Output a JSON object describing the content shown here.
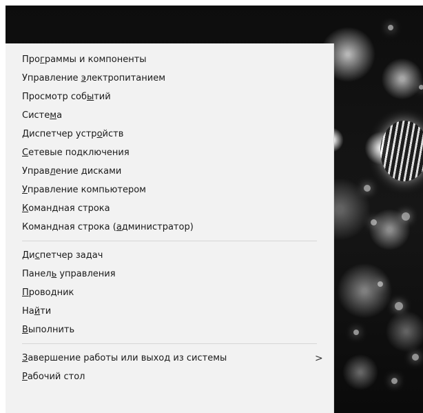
{
  "menu": {
    "items": [
      {
        "pre": "Про",
        "acc": "г",
        "post": "раммы и компоненты"
      },
      {
        "pre": "Управление ",
        "acc": "э",
        "post": "лектропитанием"
      },
      {
        "pre": "Просмотр соб",
        "acc": "ы",
        "post": "тий"
      },
      {
        "pre": "Систе",
        "acc": "м",
        "post": "а"
      },
      {
        "pre": "Диспетчер устр",
        "acc": "о",
        "post": "йств"
      },
      {
        "pre": "",
        "acc": "С",
        "post": "етевые подключения"
      },
      {
        "pre": "Управ",
        "acc": "л",
        "post": "ение дисками"
      },
      {
        "pre": "",
        "acc": "У",
        "post": "правление компьютером"
      },
      {
        "pre": "",
        "acc": "К",
        "post": "омандная строка"
      },
      {
        "pre": "Командная строка (",
        "acc": "а",
        "post": "дминистратор)"
      },
      {
        "pre": "Ди",
        "acc": "с",
        "post": "петчер задач"
      },
      {
        "pre": "Панел",
        "acc": "ь",
        "post": " управления"
      },
      {
        "pre": "",
        "acc": "П",
        "post": "роводник"
      },
      {
        "pre": "На",
        "acc": "й",
        "post": "ти"
      },
      {
        "pre": "",
        "acc": "В",
        "post": "ыполнить"
      },
      {
        "pre": "",
        "acc": "З",
        "post": "авершение работы или выход из системы"
      },
      {
        "pre": "",
        "acc": "Р",
        "post": "абочий стол"
      }
    ],
    "submenu_arrow": ">"
  }
}
